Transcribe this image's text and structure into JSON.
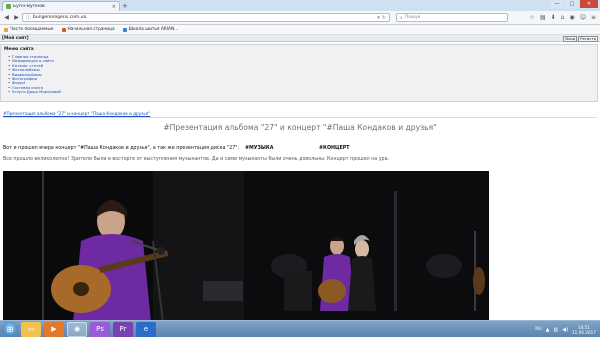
{
  "browser": {
    "tab_title": "Бугін-Вугінов",
    "tab_close": "×",
    "new_tab": "+",
    "url": "bungenorogens.com.ua",
    "search_placeholder": "Пошук",
    "window_buttons": [
      "—",
      "□",
      "✕"
    ]
  },
  "bookmarks": [
    {
      "label": "Часто посещаемые",
      "color": "#e6a23c"
    },
    {
      "label": "Начальная страница",
      "color": "#e04f2f"
    },
    {
      "label": "Школа шитья ARIAN...",
      "color": "#3b7dd8"
    }
  ],
  "page": {
    "topbar_title": "[Мой сайт]",
    "topbar_buttons": [
      "Вход",
      "Регистр"
    ],
    "menu": {
      "title": "Меню сайта",
      "items": [
        "Главная страница",
        "Информация о сайте",
        "Каталог статей",
        "Фотоальбомы",
        "Видеоальбомы",
        "Фотографии",
        "Форум",
        "Гостевая книга",
        "Услуги Даши Морозовой"
      ]
    },
    "breadcrumb": "#Презентация альбома \"27\" и концерт \"Паша Кондаков и друзья\"",
    "post": {
      "title": "#Презентация альбома \"27\" и концерт \"#Паша Кондаков и друзья\"",
      "lead": "Вот и прошел вчера концерт \"#Паша Кондаков и друзья\", а так же презентация диска \"27\".",
      "tag1": "#МУЗЫКА",
      "tag2": "#КОНЦЕРТ",
      "body": "Все прошло великолепно! Зрители были в восторге от выступления музыкантов. Да и сами музыканты были очень довольны. Концерт прошел на ура."
    }
  },
  "taskbar": {
    "language": "RU",
    "time": "14:51",
    "date": "11.06.2017"
  }
}
